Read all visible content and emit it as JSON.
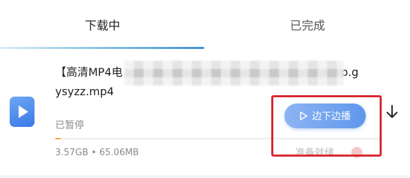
{
  "tabs": {
    "downloading": "下载中",
    "completed": "已完成"
  },
  "item": {
    "name_line1_start": "【高清MP4电",
    "name_line1_end": "p.g",
    "name_line2": "ysyzz.mp4",
    "status": "已暂停",
    "size": "3.57GB • 65.06MB",
    "progress_fraction": 0.016,
    "play_button_label": "边下边播",
    "ready_label": "准备就绪"
  },
  "colors": {
    "accent": "#3d8fd6",
    "highlight": "#d9272e",
    "progress": "#f5a623"
  },
  "icons": [
    "video-file-icon",
    "play-icon",
    "download-arrow-icon"
  ]
}
